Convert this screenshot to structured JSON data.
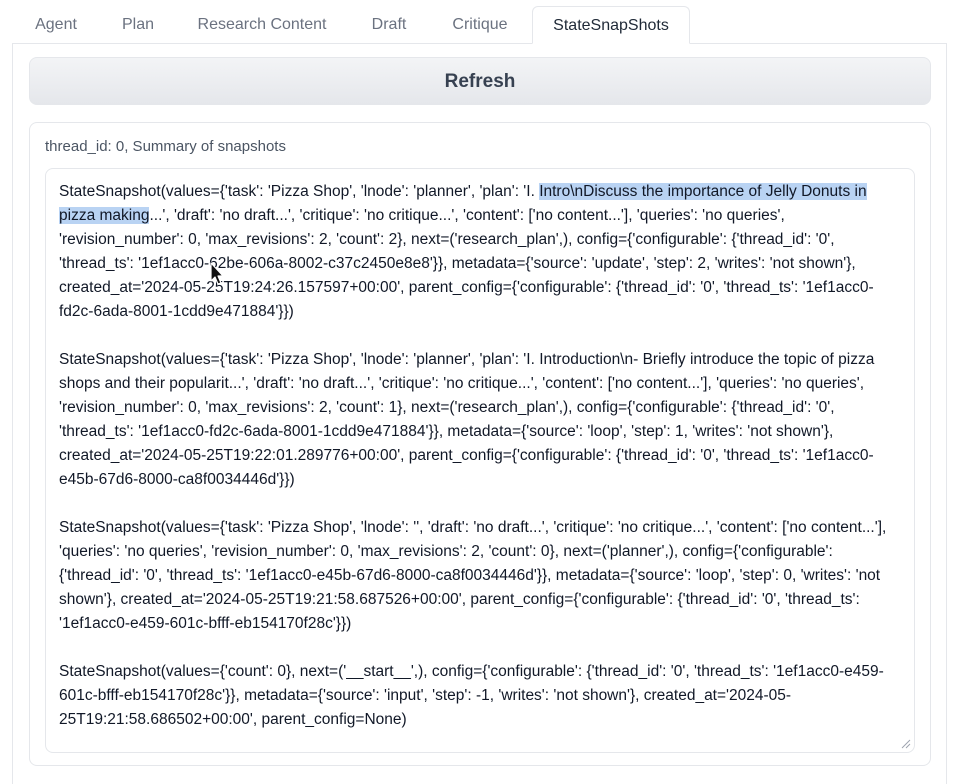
{
  "tabs": [
    {
      "label": "Agent",
      "active": false
    },
    {
      "label": "Plan",
      "active": false
    },
    {
      "label": "Research Content",
      "active": false
    },
    {
      "label": "Draft",
      "active": false
    },
    {
      "label": "Critique",
      "active": false
    },
    {
      "label": "StateSnapShots",
      "active": true
    }
  ],
  "refresh_button": {
    "label": "Refresh"
  },
  "summary": {
    "label": "thread_id: 0, Summary of snapshots",
    "snapshot_1": {
      "pre_highlight": "StateSnapshot(values={'task': 'Pizza Shop', 'lnode': 'planner', 'plan': 'I. ",
      "highlight": "Intro\\nDiscuss the importance of Jelly Donuts in pizza making",
      "post_highlight": "...', 'draft': 'no draft...', 'critique': 'no critique...', 'content': ['no content...'], 'queries': 'no queries', 'revision_number': 0, 'max_revisions': 2, 'count': 2}, next=('research_plan',), config={'configurable': {'thread_id': '0', 'thread_ts': '1ef1acc0-62be-606a-8002-c37c2450e8e8'}}, metadata={'source': 'update', 'step': 2, 'writes': 'not shown'}, created_at='2024-05-25T19:24:26.157597+00:00', parent_config={'configurable': {'thread_id': '0', 'thread_ts': '1ef1acc0-fd2c-6ada-8001-1cdd9e471884'}})"
    },
    "snapshot_2": "StateSnapshot(values={'task': 'Pizza Shop', 'lnode': 'planner', 'plan': 'I. Introduction\\n- Briefly introduce the topic of pizza shops and their popularit...', 'draft': 'no draft...', 'critique': 'no critique...', 'content': ['no content...'], 'queries': 'no queries', 'revision_number': 0, 'max_revisions': 2, 'count': 1}, next=('research_plan',), config={'configurable': {'thread_id': '0', 'thread_ts': '1ef1acc0-fd2c-6ada-8001-1cdd9e471884'}}, metadata={'source': 'loop', 'step': 1, 'writes': 'not shown'}, created_at='2024-05-25T19:22:01.289776+00:00', parent_config={'configurable': {'thread_id': '0', 'thread_ts': '1ef1acc0-e45b-67d6-8000-ca8f0034446d'}})",
    "snapshot_3": "StateSnapshot(values={'task': 'Pizza Shop', 'lnode': '', 'draft': 'no draft...', 'critique': 'no critique...', 'content': ['no content...'], 'queries': 'no queries', 'revision_number': 0, 'max_revisions': 2, 'count': 0}, next=('planner',), config={'configurable': {'thread_id': '0', 'thread_ts': '1ef1acc0-e45b-67d6-8000-ca8f0034446d'}}, metadata={'source': 'loop', 'step': 0, 'writes': 'not shown'}, created_at='2024-05-25T19:21:58.687526+00:00', parent_config={'configurable': {'thread_id': '0', 'thread_ts': '1ef1acc0-e459-601c-bfff-eb154170f28c'}})",
    "snapshot_4": "StateSnapshot(values={'count': 0}, next=('__start__',), config={'configurable': {'thread_id': '0', 'thread_ts': '1ef1acc0-e459-601c-bfff-eb154170f28c'}}, metadata={'source': 'input', 'step': -1, 'writes': 'not shown'}, created_at='2024-05-25T19:21:58.686502+00:00', parent_config=None)"
  }
}
